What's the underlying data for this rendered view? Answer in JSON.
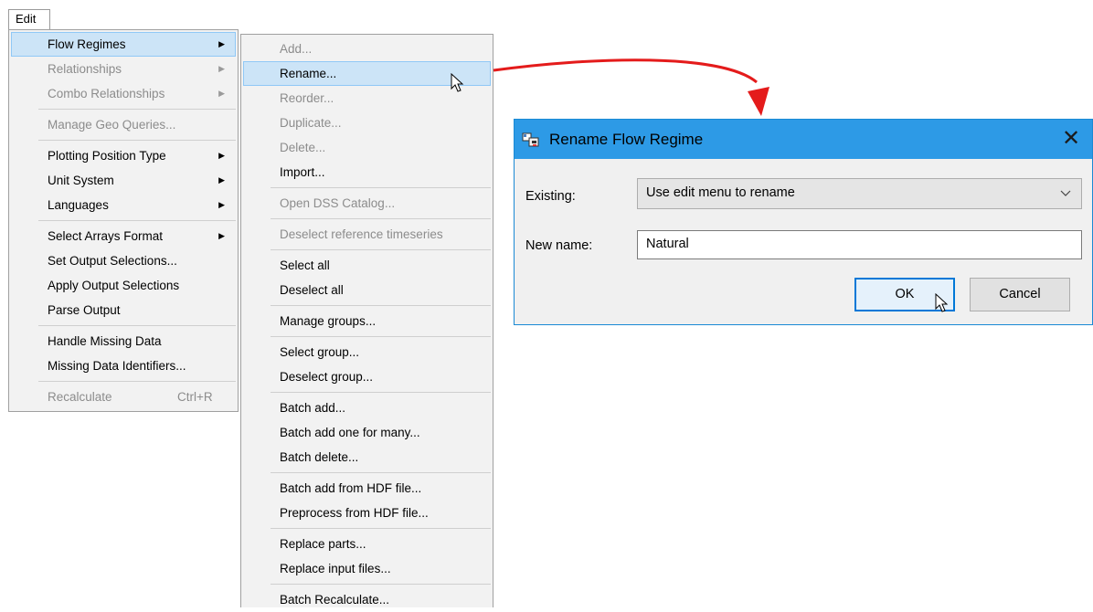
{
  "menubar": {
    "edit_label": "Edit"
  },
  "edit_menu": {
    "groups": [
      [
        {
          "label": "Flow Regimes",
          "submenu": true,
          "enabled": true,
          "highlight": true
        },
        {
          "label": "Relationships",
          "submenu": true,
          "enabled": false
        },
        {
          "label": "Combo Relationships",
          "submenu": true,
          "enabled": false
        }
      ],
      [
        {
          "label": "Manage Geo Queries...",
          "enabled": false
        }
      ],
      [
        {
          "label": "Plotting Position Type",
          "submenu": true,
          "enabled": true
        },
        {
          "label": "Unit System",
          "submenu": true,
          "enabled": true
        },
        {
          "label": "Languages",
          "submenu": true,
          "enabled": true
        }
      ],
      [
        {
          "label": "Select Arrays Format",
          "submenu": true,
          "enabled": true
        },
        {
          "label": "Set Output Selections...",
          "enabled": true
        },
        {
          "label": "Apply Output Selections",
          "enabled": true
        },
        {
          "label": "Parse Output",
          "enabled": true
        }
      ],
      [
        {
          "label": "Handle Missing Data",
          "enabled": true
        },
        {
          "label": "Missing Data Identifiers...",
          "enabled": true
        }
      ],
      [
        {
          "label": "Recalculate",
          "shortcut": "Ctrl+R",
          "enabled": false
        }
      ]
    ]
  },
  "flow_regimes_submenu": {
    "groups": [
      [
        {
          "label": "Add...",
          "enabled": false
        },
        {
          "label": "Rename...",
          "enabled": true,
          "highlight": true
        },
        {
          "label": "Reorder...",
          "enabled": false
        },
        {
          "label": "Duplicate...",
          "enabled": false
        },
        {
          "label": "Delete...",
          "enabled": false
        },
        {
          "label": "Import...",
          "enabled": true
        }
      ],
      [
        {
          "label": "Open DSS Catalog...",
          "enabled": false
        }
      ],
      [
        {
          "label": "Deselect reference timeseries",
          "enabled": false
        }
      ],
      [
        {
          "label": "Select all",
          "enabled": true
        },
        {
          "label": "Deselect all",
          "enabled": true
        }
      ],
      [
        {
          "label": "Manage groups...",
          "enabled": true
        }
      ],
      [
        {
          "label": "Select group...",
          "enabled": true
        },
        {
          "label": "Deselect group...",
          "enabled": true
        }
      ],
      [
        {
          "label": "Batch add...",
          "enabled": true
        },
        {
          "label": "Batch add one for many...",
          "enabled": true
        },
        {
          "label": "Batch delete...",
          "enabled": true
        }
      ],
      [
        {
          "label": "Batch add from HDF file...",
          "enabled": true
        },
        {
          "label": "Preprocess from HDF file...",
          "enabled": true
        }
      ],
      [
        {
          "label": "Replace parts...",
          "enabled": true
        },
        {
          "label": "Replace input files...",
          "enabled": true
        }
      ],
      [
        {
          "label": "Batch Recalculate...",
          "enabled": true
        }
      ]
    ]
  },
  "dialog": {
    "title": "Rename Flow Regime",
    "existing_label": "Existing:",
    "existing_value": "Use edit menu to rename",
    "new_name_label": "New name:",
    "new_name_value": "Natural",
    "ok_label": "OK",
    "cancel_label": "Cancel"
  },
  "colors": {
    "accent": "#2d9ae6",
    "highlight": "#cce4f7",
    "arrow": "#e41b1b"
  },
  "icons": {
    "submenu_arrow": "▶",
    "close": "✕",
    "dropdown": "chevron-down-icon"
  }
}
